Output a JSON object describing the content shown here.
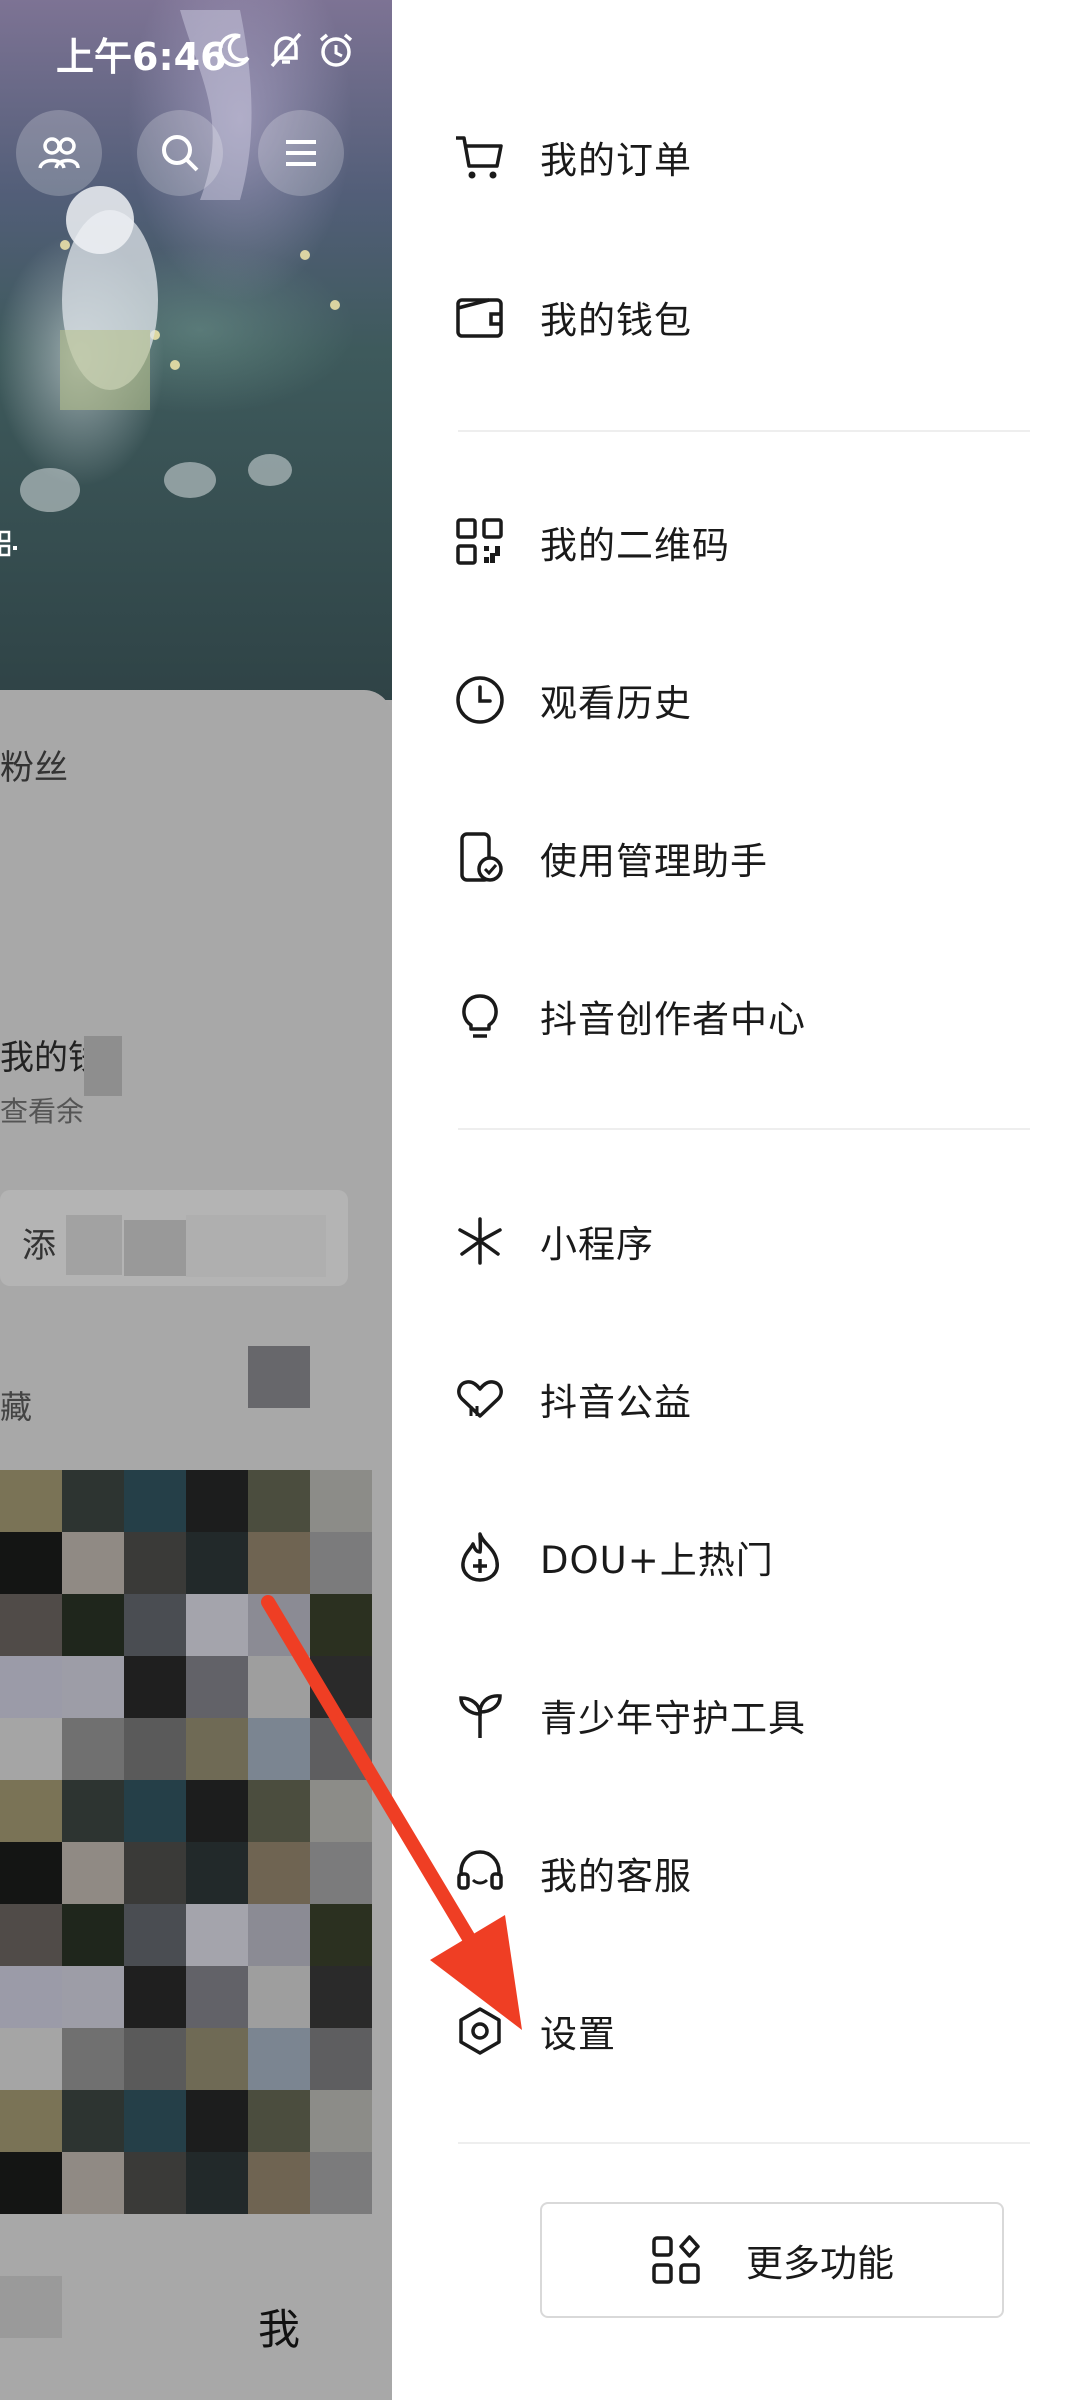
{
  "status_bar": {
    "time": "上午6:46"
  },
  "profile": {
    "fans_label": "粉丝",
    "wallet_title": "我的钱",
    "wallet_sub": "查看余",
    "add_button": "添",
    "favorites": "藏",
    "tab_me": "我"
  },
  "drawer": {
    "items": [
      {
        "label": "我的订单",
        "icon": "cart-icon"
      },
      {
        "label": "我的钱包",
        "icon": "wallet-icon"
      },
      {
        "label": "我的二维码",
        "icon": "qr-code-icon"
      },
      {
        "label": "观看历史",
        "icon": "clock-icon"
      },
      {
        "label": "使用管理助手",
        "icon": "phone-check-icon"
      },
      {
        "label": "抖音创作者中心",
        "icon": "lightbulb-icon"
      },
      {
        "label": "小程序",
        "icon": "mini-program-icon"
      },
      {
        "label": "抖音公益",
        "icon": "heart-hands-icon"
      },
      {
        "label": "DOU+上热门",
        "icon": "flame-plus-icon"
      },
      {
        "label": "青少年守护工具",
        "icon": "sprout-icon"
      },
      {
        "label": "我的客服",
        "icon": "headset-icon"
      },
      {
        "label": "设置",
        "icon": "gear-icon"
      }
    ],
    "more_button": "更多功能"
  },
  "colors": {
    "annotation_arrow": "#ef3e24",
    "text": "#1a1a1a",
    "divider": "#eeeeee"
  }
}
